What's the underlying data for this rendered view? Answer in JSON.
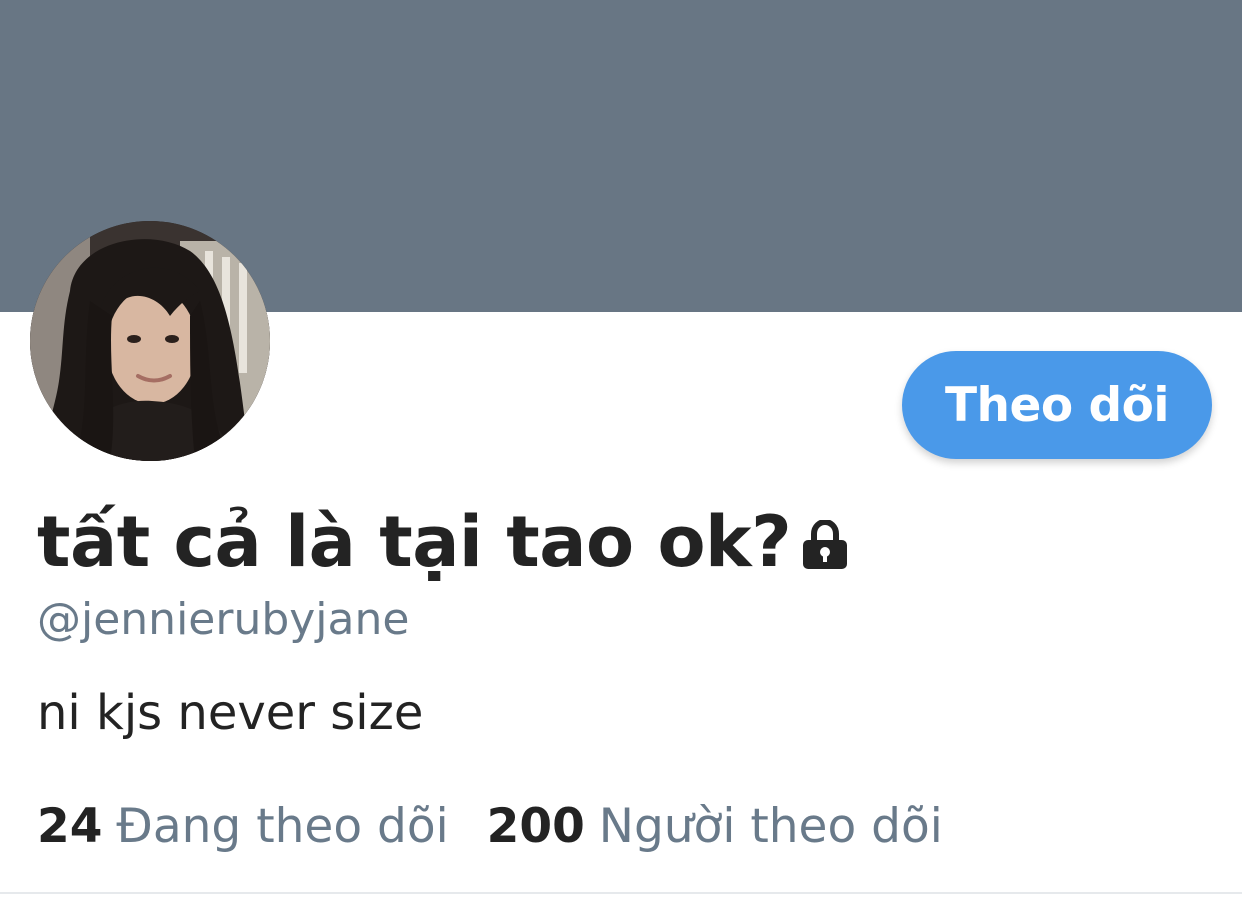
{
  "profile": {
    "display_name": "tất cả là tại tao ok?",
    "handle": "@jennierubyjane",
    "bio": "ni kjs never size",
    "protected": true
  },
  "actions": {
    "follow_label": "Theo dõi"
  },
  "stats": {
    "following_count": "24",
    "following_label": "Đang theo dõi",
    "followers_count": "200",
    "followers_label": "Người theo dõi"
  },
  "colors": {
    "banner": "#687684",
    "accent": "#4a99e9",
    "text_primary": "#232323",
    "text_secondary": "#697a8a"
  },
  "icons": {
    "protected": "lock-icon"
  }
}
